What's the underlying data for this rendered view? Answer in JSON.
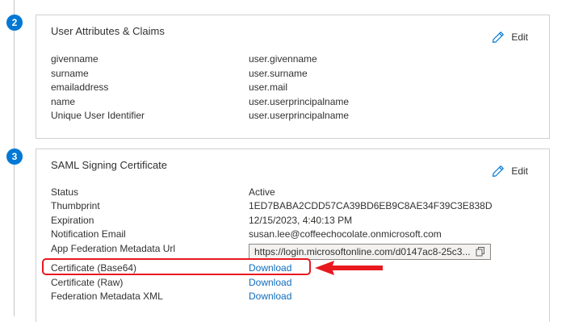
{
  "steps": [
    {
      "number": "2"
    },
    {
      "number": "3"
    }
  ],
  "attributes_card": {
    "title": "User Attributes & Claims",
    "edit_label": "Edit",
    "edit_icon": "pencil-icon",
    "rows": [
      {
        "label": "givenname",
        "value": "user.givenname"
      },
      {
        "label": "surname",
        "value": "user.surname"
      },
      {
        "label": "emailaddress",
        "value": "user.mail"
      },
      {
        "label": "name",
        "value": "user.userprincipalname"
      },
      {
        "label": "Unique User Identifier",
        "value": "user.userprincipalname"
      }
    ]
  },
  "certificate_card": {
    "title": "SAML Signing Certificate",
    "edit_label": "Edit",
    "edit_icon": "pencil-icon",
    "rows": [
      {
        "label": "Status",
        "value": "Active"
      },
      {
        "label": "Thumbprint",
        "value": "1ED7BABA2CDD57CA39BD6EB9C8AE34F39C3E838D"
      },
      {
        "label": "Expiration",
        "value": "12/15/2023, 4:40:13 PM"
      },
      {
        "label": "Notification Email",
        "value": "susan.lee@coffeechocolate.onmicrosoft.com"
      },
      {
        "label": "App Federation Metadata Url",
        "value": "https://login.microsoftonline.com/d0147ac8-25c3..."
      },
      {
        "label": "Certificate (Base64)",
        "value": "Download"
      },
      {
        "label": "Certificate (Raw)",
        "value": "Download"
      },
      {
        "label": "Federation Metadata XML",
        "value": "Download"
      }
    ],
    "copy_icon": "copy-icon"
  },
  "colors": {
    "accent": "#0078d4",
    "link": "#0f6cbd",
    "highlight": "#e8191f",
    "border": "#d2d0ce"
  }
}
